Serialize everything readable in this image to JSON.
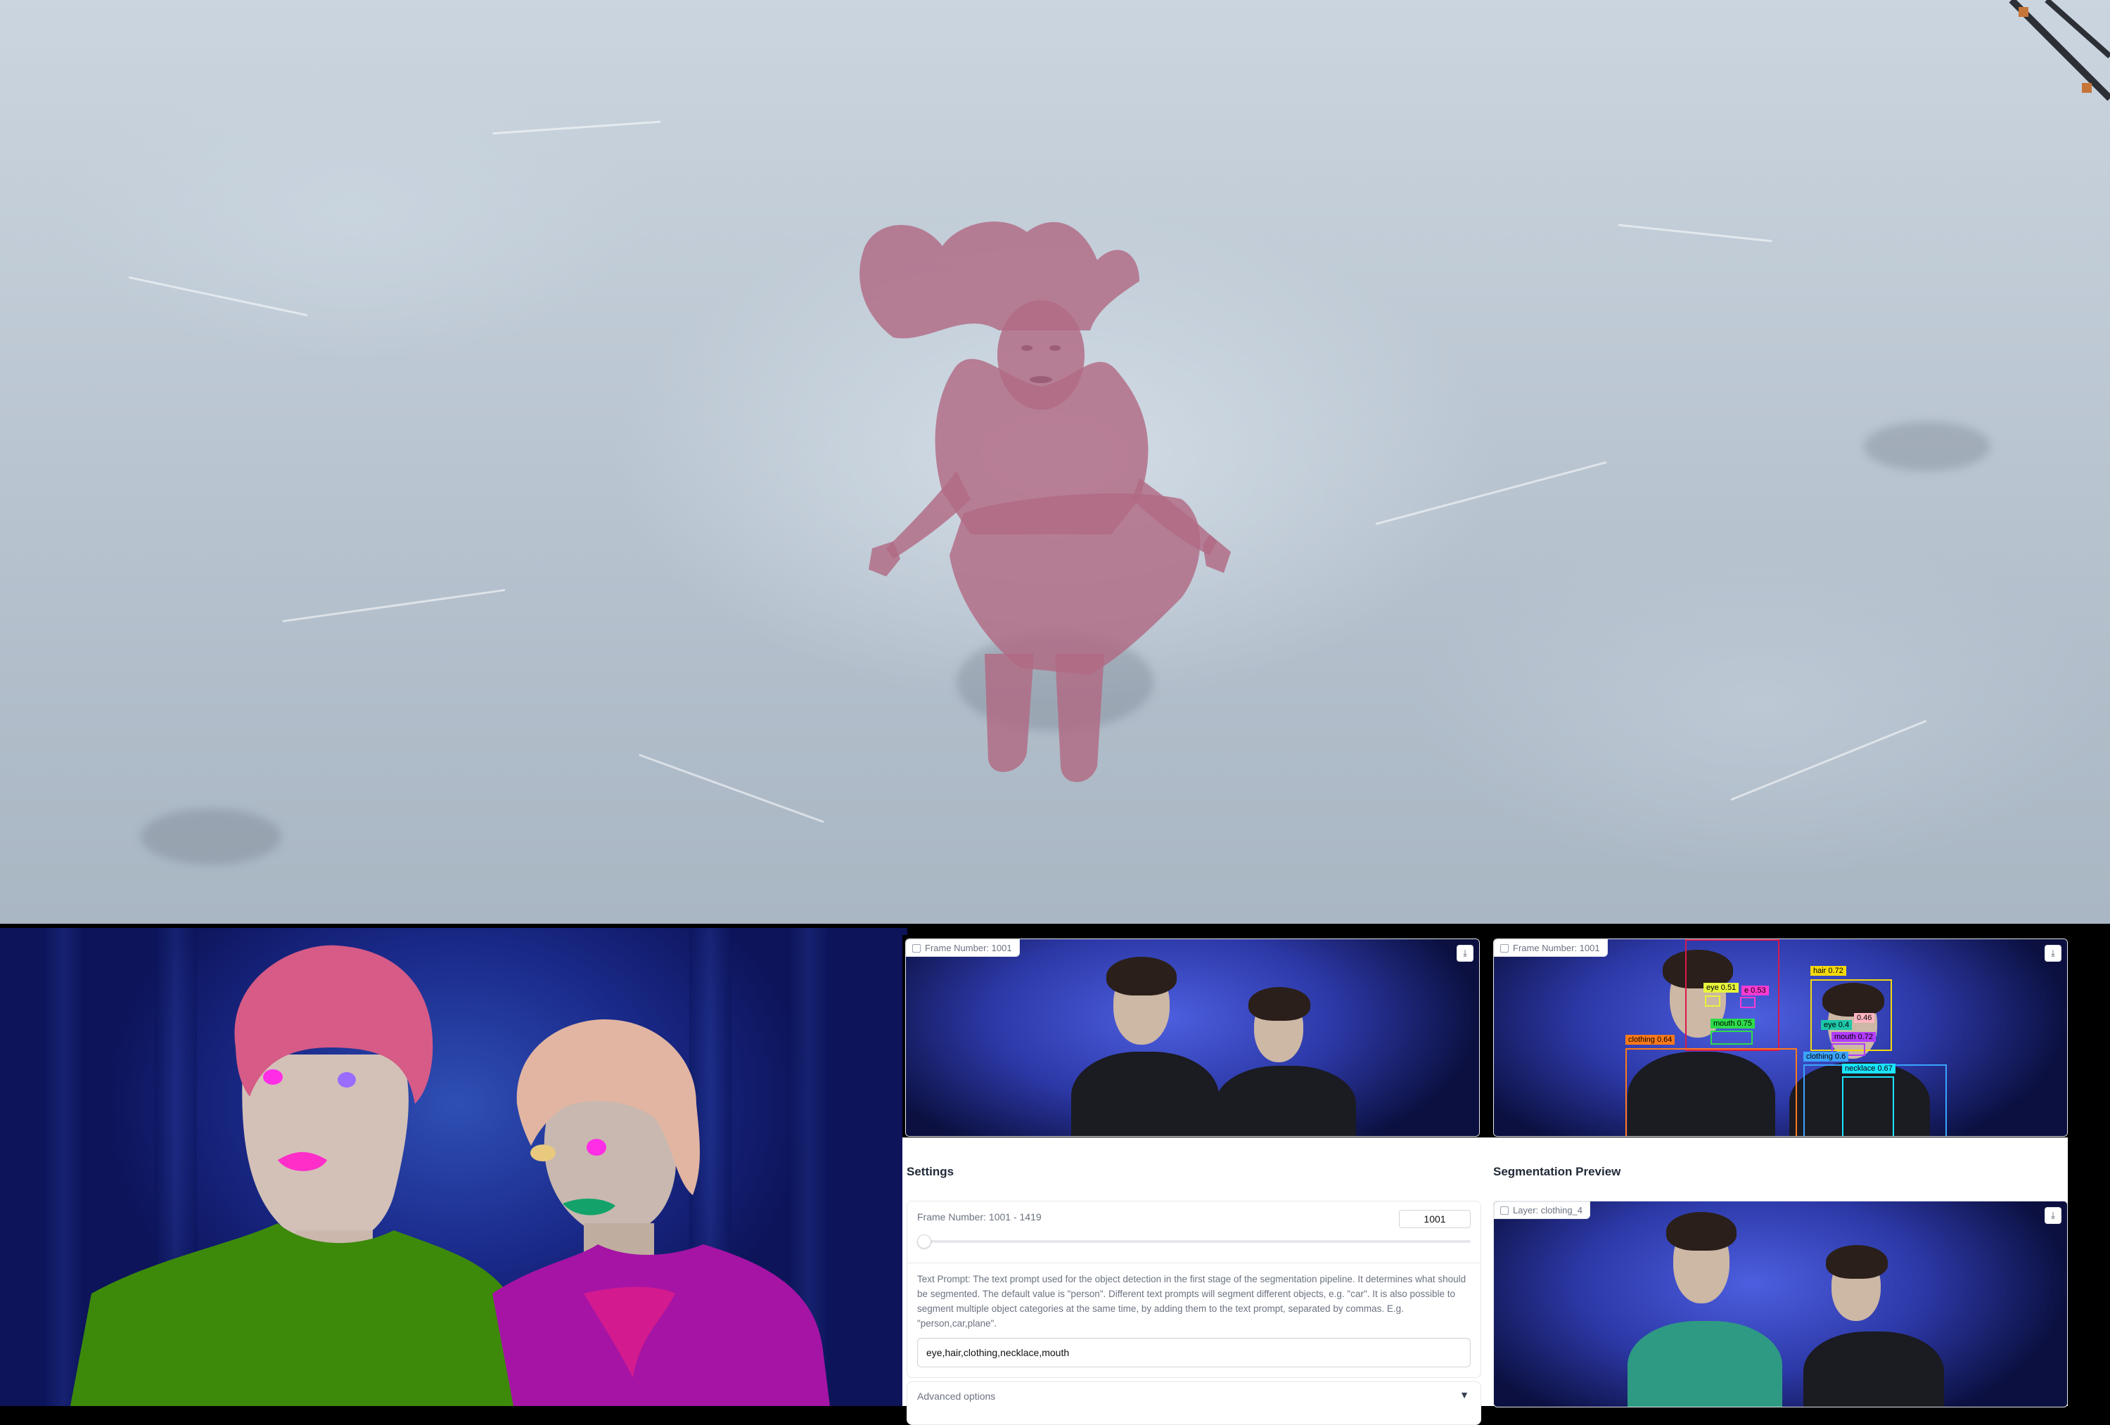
{
  "panels": {
    "frame_input": {
      "label": "Frame Number: 1001"
    },
    "frame_detection": {
      "label": "Frame Number: 1001"
    },
    "layer_preview": {
      "label": "Layer: clothing_4"
    }
  },
  "detections": [
    {
      "label": "hair 0.72",
      "color": "#f5d90a"
    },
    {
      "label": "eye 0.51",
      "color": "#e6f53b"
    },
    {
      "label": "e 0.53",
      "color": "#ff3bd4"
    },
    {
      "label": "0.46",
      "color": "#ffb6c1"
    },
    {
      "label": "eye 0.4",
      "color": "#1cc7a9"
    },
    {
      "label": "mouth 0.75",
      "color": "#2ddc4a"
    },
    {
      "label": "mouth 0.72",
      "color": "#b23cff"
    },
    {
      "label": "clothing 0.64",
      "color": "#ff7a1a"
    },
    {
      "label": "clothing 0.6",
      "color": "#3ba4ff"
    },
    {
      "label": "necklace 0.67",
      "color": "#1be4ff"
    }
  ],
  "settings": {
    "title": "Settings",
    "frame_slider_label": "Frame Number: 1001 - 1419",
    "frame_value": "1001",
    "prompt_help": "Text Prompt: The text prompt used for the object detection in the first stage of the segmentation pipeline. It determines what should be segmented. The default value is \"person\". Different text prompts will segment different objects, e.g. \"car\". It is also possible to segment multiple object categories at the same time, by adding them to the text prompt, separated by commas. E.g. \"person,car,plane\".",
    "prompt_value": "eye,hair,clothing,necklace,mouth",
    "advanced_label": "Advanced options"
  },
  "preview": {
    "title": "Segmentation Preview"
  },
  "icons": {
    "download": "download-icon",
    "image": "image-icon",
    "chevron": "chevron-down-icon"
  }
}
